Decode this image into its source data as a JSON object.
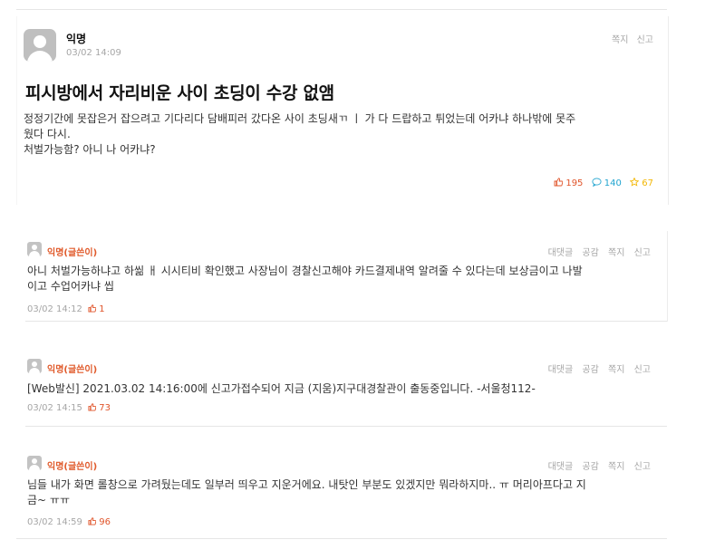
{
  "article": {
    "author": "익명",
    "datetime": "03/02 14:09",
    "actions": [
      "쪽지",
      "신고"
    ],
    "title": "피시방에서 자리비운 사이 초딩이 수강 없앰",
    "content_lines": [
      "정정기간에 못잡은거 잡으려고 기다리다 담배피러 갔다온 사이 초딩새ㄲ ㅣ 가 다 드랍하고 튀었는데 어카냐 하나밖에 못주",
      "웠다 다시.",
      "처벌가능함? 아니 나 어카냐?"
    ],
    "stats": {
      "likes": "195",
      "comments": "140",
      "scraps": "67"
    }
  },
  "comments": [
    {
      "author": "익명(글쓴이)",
      "actions": [
        "대댓글",
        "공감",
        "쪽지",
        "신고"
      ],
      "text_lines": [
        "아니 처벌가능하냐고 하씲 ㅐ 시시티비 확인했고 사장님이 경찰신고해야 카드결제내역 알려줄 수 있다는데 보상금이고 나발",
        "이고 수업어카냐 씹"
      ],
      "datetime": "03/02 14:12",
      "likes": "1"
    },
    {
      "author": "익명(글쓴이)",
      "actions": [
        "대댓글",
        "공감",
        "쪽지",
        "신고"
      ],
      "text_lines": [
        "[Web발신] 2021.03.02 14:16:00에 신고가접수되어 지금 (지움)지구대경찰관이 출동중입니다. -서울청112-"
      ],
      "datetime": "03/02 14:15",
      "likes": "73"
    },
    {
      "author": "익명(글쓴이)",
      "actions": [
        "대댓글",
        "공감",
        "쪽지",
        "신고"
      ],
      "text_lines": [
        "님들 내가 화면 롤창으로 가려뒀는데도 일부러 띄우고 지운거에요. 내탓인 부분도 있겠지만 뭐라하지마.. ㅠ 머리아프다고 지",
        "금~ ㅠㅠ"
      ],
      "datetime": "03/02 14:59",
      "likes": "96"
    }
  ],
  "colors": {
    "accent": "#e05a2b",
    "comment_blue": "#21a4cf",
    "scrap_yellow": "#f2b705",
    "meta_gray": "#a6a6a6"
  },
  "icons": {
    "like": "thumbs-up-icon",
    "comment": "speech-bubble-icon",
    "scrap": "star-icon",
    "avatar": "user-avatar-icon"
  }
}
